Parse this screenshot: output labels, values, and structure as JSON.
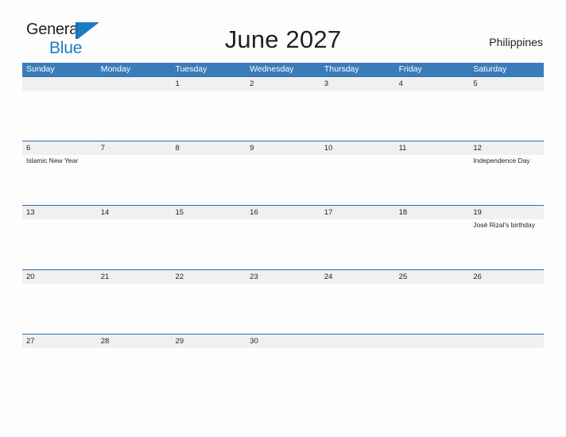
{
  "brand": {
    "name_part1": "General",
    "name_part2": "Blue",
    "logo_icon": "triangle-flag-icon",
    "accent_color": "#1a7dc4"
  },
  "header": {
    "title": "June 2027",
    "region": "Philippines"
  },
  "colors": {
    "header_band": "#3a7cba",
    "date_band": "#f0f0f0",
    "rule": "#2e6da4",
    "page_background": "#fdfdfe",
    "text": "#231f20"
  },
  "calendar": {
    "weekdays": [
      "Sunday",
      "Monday",
      "Tuesday",
      "Wednesday",
      "Thursday",
      "Friday",
      "Saturday"
    ],
    "weeks": [
      {
        "days": [
          {
            "date": "",
            "event": ""
          },
          {
            "date": "",
            "event": ""
          },
          {
            "date": "1",
            "event": ""
          },
          {
            "date": "2",
            "event": ""
          },
          {
            "date": "3",
            "event": ""
          },
          {
            "date": "4",
            "event": ""
          },
          {
            "date": "5",
            "event": ""
          }
        ]
      },
      {
        "days": [
          {
            "date": "6",
            "event": "Islamic New Year"
          },
          {
            "date": "7",
            "event": ""
          },
          {
            "date": "8",
            "event": ""
          },
          {
            "date": "9",
            "event": ""
          },
          {
            "date": "10",
            "event": ""
          },
          {
            "date": "11",
            "event": ""
          },
          {
            "date": "12",
            "event": "Independence Day"
          }
        ]
      },
      {
        "days": [
          {
            "date": "13",
            "event": ""
          },
          {
            "date": "14",
            "event": ""
          },
          {
            "date": "15",
            "event": ""
          },
          {
            "date": "16",
            "event": ""
          },
          {
            "date": "17",
            "event": ""
          },
          {
            "date": "18",
            "event": ""
          },
          {
            "date": "19",
            "event": "José Rizal's birthday"
          }
        ]
      },
      {
        "days": [
          {
            "date": "20",
            "event": ""
          },
          {
            "date": "21",
            "event": ""
          },
          {
            "date": "22",
            "event": ""
          },
          {
            "date": "23",
            "event": ""
          },
          {
            "date": "24",
            "event": ""
          },
          {
            "date": "25",
            "event": ""
          },
          {
            "date": "26",
            "event": ""
          }
        ]
      },
      {
        "days": [
          {
            "date": "27",
            "event": ""
          },
          {
            "date": "28",
            "event": ""
          },
          {
            "date": "29",
            "event": ""
          },
          {
            "date": "30",
            "event": ""
          },
          {
            "date": "",
            "event": ""
          },
          {
            "date": "",
            "event": ""
          },
          {
            "date": "",
            "event": ""
          }
        ]
      }
    ]
  }
}
